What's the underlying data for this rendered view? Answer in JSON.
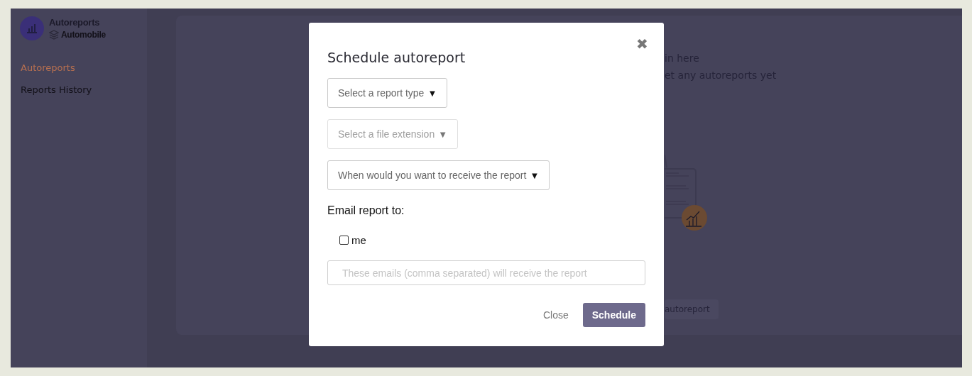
{
  "sidebar": {
    "app_name": "Autoreports",
    "workspace": "Automobile",
    "items": [
      {
        "label": "Autoreports",
        "selected": true
      },
      {
        "label": "Reports History",
        "selected": false
      }
    ]
  },
  "main": {
    "empty_lines": [
      "in here",
      "et any autoreports yet"
    ],
    "create_button": "autoreport"
  },
  "modal": {
    "title": "Schedule autoreport",
    "close_icon": "✖",
    "selects": [
      {
        "placeholder": "Select a report type",
        "caret": "▼",
        "disabled": false
      },
      {
        "placeholder": "Select a file extension",
        "caret": "▼",
        "disabled": true
      },
      {
        "placeholder": "When would you want to receive the report",
        "caret": "▼",
        "disabled": false
      }
    ],
    "email_label": "Email report to:",
    "me_option": {
      "label": "me",
      "checked": false
    },
    "emails_field": {
      "placeholder": "These emails (comma separated) will receive the report"
    },
    "buttons": [
      {
        "label": "Close",
        "kind": "link"
      },
      {
        "label": "Schedule",
        "kind": "primary"
      }
    ]
  }
}
